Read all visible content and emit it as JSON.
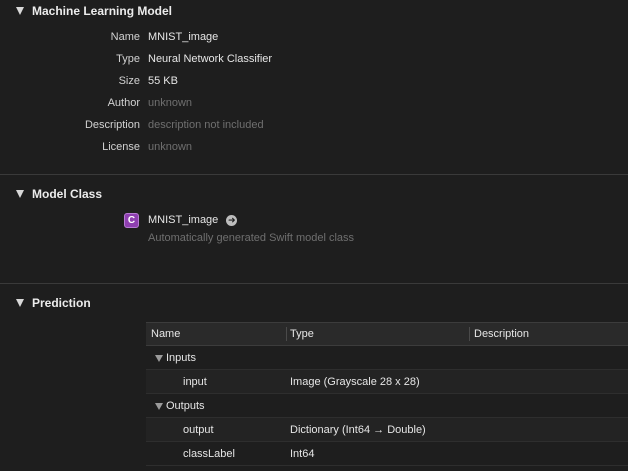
{
  "sections": {
    "model": {
      "title": "Machine Learning Model",
      "fields": [
        {
          "label": "Name",
          "value": "MNIST_image",
          "muted": false
        },
        {
          "label": "Type",
          "value": "Neural Network Classifier",
          "muted": false
        },
        {
          "label": "Size",
          "value": "55 KB",
          "muted": false
        },
        {
          "label": "Author",
          "value": "unknown",
          "muted": true
        },
        {
          "label": "Description",
          "value": "description not included",
          "muted": true
        },
        {
          "label": "License",
          "value": "unknown",
          "muted": true
        }
      ]
    },
    "model_class": {
      "title": "Model Class",
      "icon_letter": "C",
      "icon": "swift-class-icon",
      "class_name": "MNIST_image",
      "go_icon": "arrow-circle-right-icon",
      "description": "Automatically generated Swift model class"
    },
    "prediction": {
      "title": "Prediction",
      "columns": [
        "Name",
        "Type",
        "Description"
      ],
      "inputs_label": "Inputs",
      "outputs_label": "Outputs",
      "inputs": [
        {
          "name": "input",
          "type": "Image (Grayscale 28 x 28)"
        }
      ],
      "outputs": [
        {
          "name": "output",
          "type": "Dictionary (Int64 → Double)"
        },
        {
          "name": "classLabel",
          "type": "Int64"
        }
      ]
    }
  },
  "colors": {
    "background": "#1e1e1e",
    "class_icon": "#8e3fb0",
    "muted_text": "#6f6f6f"
  }
}
